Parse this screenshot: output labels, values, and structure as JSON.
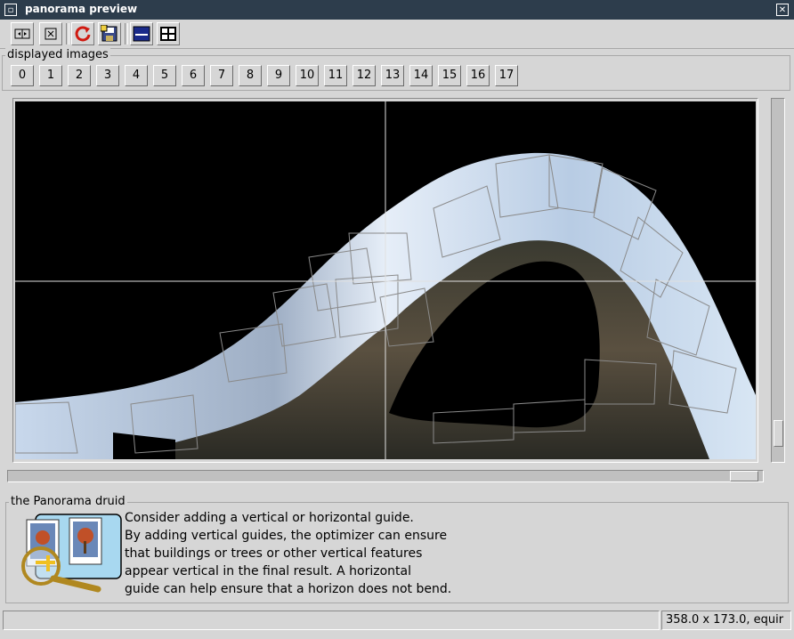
{
  "window": {
    "title": "panorama preview"
  },
  "toolbar": {
    "buttons": [
      {
        "icon": "fit-view-icon"
      },
      {
        "icon": "center-view-icon"
      },
      {
        "icon": "refresh-icon"
      },
      {
        "icon": "save-icon"
      },
      {
        "icon": "single-view-icon"
      },
      {
        "icon": "grid-view-icon"
      }
    ]
  },
  "displayed_images": {
    "label": "displayed images",
    "buttons": [
      "0",
      "1",
      "2",
      "3",
      "4",
      "5",
      "6",
      "7",
      "8",
      "9",
      "10",
      "11",
      "12",
      "13",
      "14",
      "15",
      "16",
      "17"
    ]
  },
  "druid": {
    "label": "the Panorama druid",
    "lines": [
      "Consider adding a vertical or horizontal guide.",
      "By adding vertical guides, the optimizer can ensure",
      "that buildings or trees or other vertical features",
      "appear vertical in the final result.  A horizontal",
      "guide can help ensure that a horizon does not bend."
    ]
  },
  "status": {
    "left": "",
    "right": "358.0 x 173.0, equir"
  },
  "colors": {
    "titlebar": "#2d3d4c",
    "window_bg": "#d6d6d6",
    "preview_bg": "#000000",
    "guide": "#e0e0e0"
  }
}
